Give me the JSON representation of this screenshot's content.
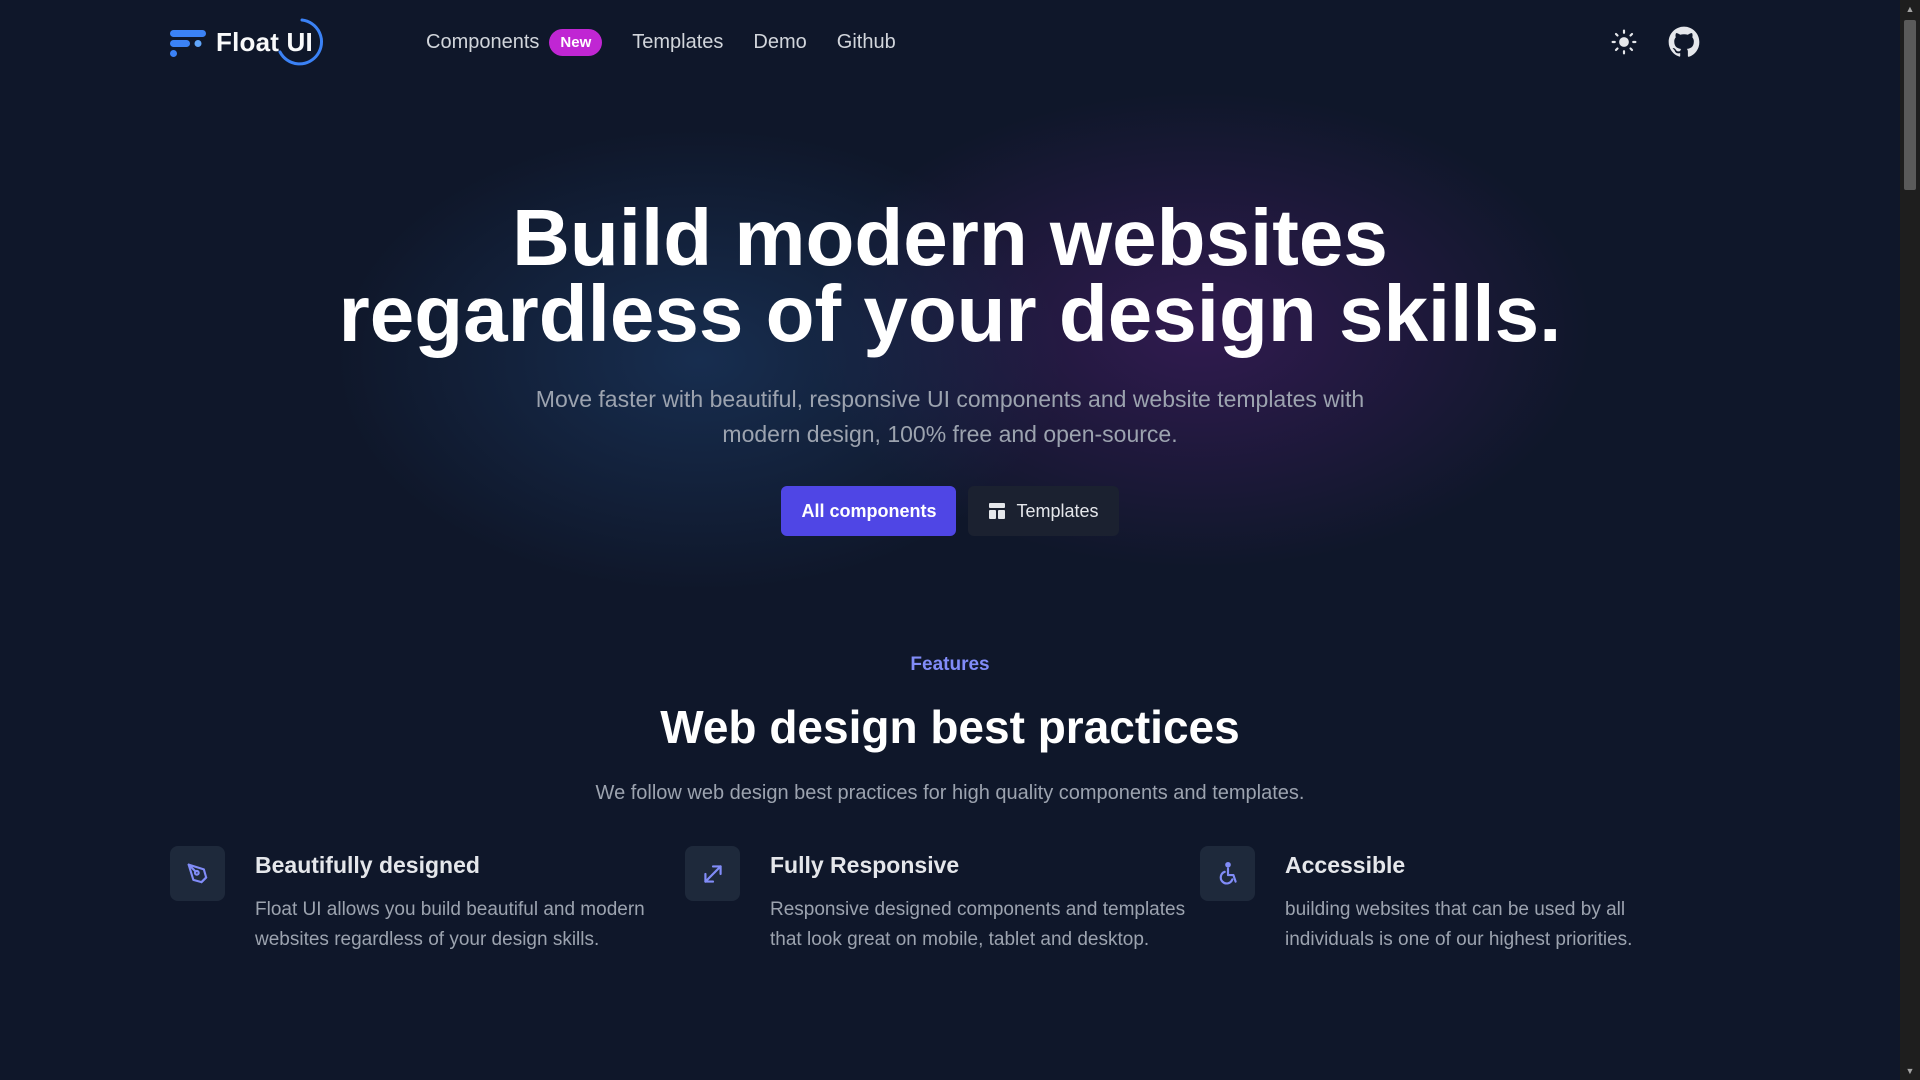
{
  "brand": {
    "name": "Float UI"
  },
  "nav": {
    "items": [
      {
        "label": "Components",
        "badge": "New"
      },
      {
        "label": "Templates"
      },
      {
        "label": "Demo"
      },
      {
        "label": "Github"
      }
    ]
  },
  "header_icons": [
    "sun-icon",
    "github-icon"
  ],
  "hero": {
    "title_line1": "Build modern websites",
    "title_line2": "regardless of your design skills.",
    "subtitle": "Move faster with beautiful, responsive UI components and website templates with modern design, 100% free and open-source.",
    "primary_cta": "All components",
    "secondary_cta": "Templates"
  },
  "features": {
    "eyebrow": "Features",
    "title": "Web design best practices",
    "subtitle": "We follow web design best practices for high quality components and templates.",
    "items": [
      {
        "icon": "pen-tool-icon",
        "title": "Beautifully designed",
        "description": "Float UI allows you build beautiful and modern websites regardless of your design skills."
      },
      {
        "icon": "resize-arrows-icon",
        "title": "Fully Responsive",
        "description": "Responsive designed components and templates that look great on mobile, tablet and desktop."
      },
      {
        "icon": "accessibility-icon",
        "title": "Accessible",
        "description": "building websites that can be used by all individuals is one of our highest priorities."
      }
    ]
  },
  "colors": {
    "background": "#0f172a",
    "accent": "#4f46e5",
    "badge": "#c026d3",
    "eyebrow": "#818cf8"
  }
}
